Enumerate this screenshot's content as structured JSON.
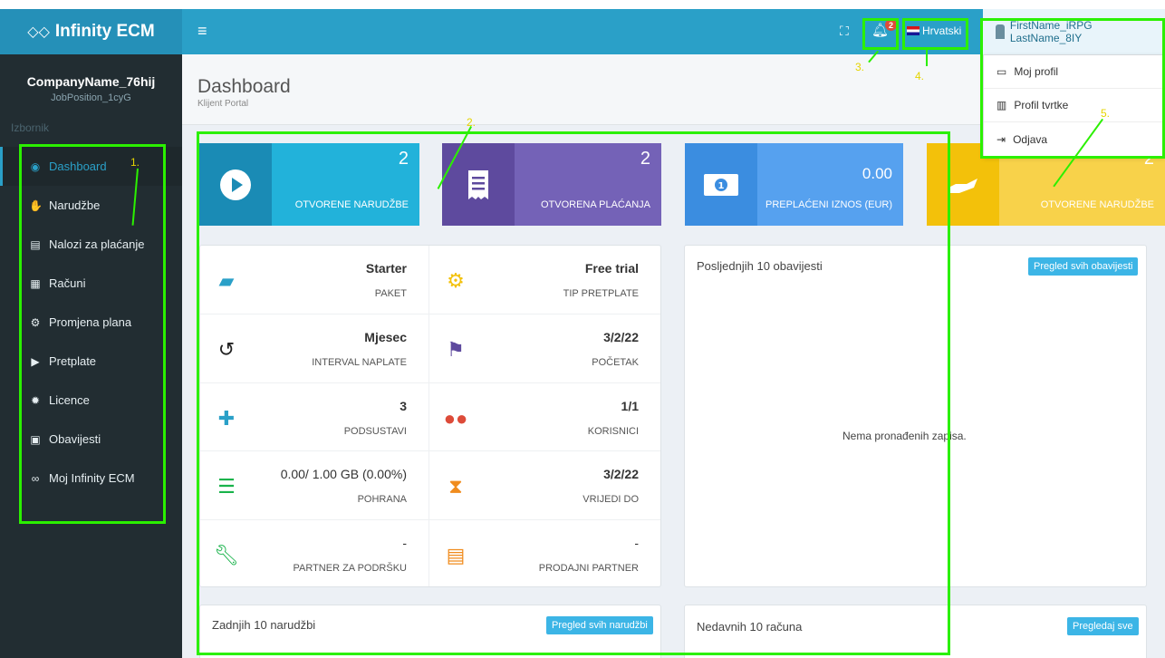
{
  "header": {
    "logo_text": "Infinity ECM",
    "logo_icon": "infinity-icon",
    "menu_toggle": "≡",
    "notification_count": "2",
    "language": "Hrvatski",
    "user_name": "FirstName_iRPG LastName_8IY"
  },
  "sidebar": {
    "company": "CompanyName_76hij",
    "job_position": "JobPosition_1cyG",
    "menu_header": "Izbornik",
    "items": [
      {
        "label": "Dashboard",
        "icon": "dashboard-icon"
      },
      {
        "label": "Narudžbe",
        "icon": "handshake-icon"
      },
      {
        "label": "Nalozi za plaćanje",
        "icon": "invoice-icon"
      },
      {
        "label": "Računi",
        "icon": "list-icon"
      },
      {
        "label": "Promjena plana",
        "icon": "gears-icon"
      },
      {
        "label": "Pretplate",
        "icon": "play-icon"
      },
      {
        "label": "Licence",
        "icon": "certificate-icon"
      },
      {
        "label": "Obavijesti",
        "icon": "newspaper-icon"
      },
      {
        "label": "Moj Infinity ECM",
        "icon": "infinity-icon"
      }
    ]
  },
  "content_header": {
    "title": "Dashboard",
    "subtitle": "Klijent Portal"
  },
  "info_boxes": [
    {
      "value": "2",
      "label": "OTVORENE NARUDŽBE",
      "icon": "play-circle-icon",
      "color_icon": "#1a8bb5",
      "color_body": "#22b2da"
    },
    {
      "value": "2",
      "label": "OTVORENA PLAĆANJA",
      "icon": "receipt-icon",
      "color_icon": "#5e4a9e",
      "color_body": "#7462b7"
    },
    {
      "value": "0.00",
      "label": "PREPLAĆENI IZNOS (EUR)",
      "icon": "money-bill-icon",
      "color_icon": "#3b8de0",
      "color_body": "#56a1ef"
    },
    {
      "value": "2",
      "label": "OTVORENE NARUDŽBE",
      "icon": "hand-holding-icon",
      "color_icon": "#f3c10a",
      "color_body": "#f8d24a"
    }
  ],
  "stats": [
    {
      "value": "Starter",
      "label": "PAKET",
      "icon": "box-open-icon",
      "color": "#2aa0c8"
    },
    {
      "value": "Free trial",
      "label": "TIP PRETPLATE",
      "icon": "cog-icon",
      "color": "#f3c10a"
    },
    {
      "value": "Mjesec",
      "label": "INTERVAL NAPLATE",
      "icon": "history-icon",
      "color": "#222222"
    },
    {
      "value": "3/2/22",
      "label": "POČETAK",
      "icon": "flag-icon",
      "color": "#5e4a9e"
    },
    {
      "value": "3",
      "label": "PODSUSTAVI",
      "icon": "puzzle-icon",
      "color": "#2aa0c8"
    },
    {
      "value": "1/1",
      "label": "KORISNICI",
      "icon": "users-icon",
      "color": "#dd4b39"
    },
    {
      "value": "0.00/ 1.00 GB (0.00%)",
      "label": "POHRANA",
      "icon": "database-icon",
      "color": "#19b34b"
    },
    {
      "value": "3/2/22",
      "label": "VRIJEDI DO",
      "icon": "hourglass-icon",
      "color": "#f08c1e"
    },
    {
      "value": "-",
      "label": "PARTNER ZA PODRŠKU",
      "icon": "wrench-icon",
      "color": "#19b34b"
    },
    {
      "value": "-",
      "label": "PRODAJNI PARTNER",
      "icon": "receipt-icon",
      "color": "#f08c1e"
    }
  ],
  "notifications_panel": {
    "title": "Posljednjih 10 obavijesti",
    "button": "Pregled svih obavijesti",
    "empty": "Nema pronađenih zapisa."
  },
  "orders_panel": {
    "title": "Zadnjih 10 narudžbi",
    "button": "Pregled svih narudžbi"
  },
  "invoices_panel": {
    "title": "Nedavnih 10 računa",
    "button": "Pregledaj sve"
  },
  "user_dropdown": {
    "items": [
      {
        "label": "Moj profil",
        "icon": "id-card-icon"
      },
      {
        "label": "Profil tvrtke",
        "icon": "building-icon"
      },
      {
        "label": "Odjava",
        "icon": "sign-out-icon"
      }
    ]
  },
  "annotations": [
    "1.",
    "2.",
    "2.",
    "3.",
    "4.",
    "5."
  ]
}
